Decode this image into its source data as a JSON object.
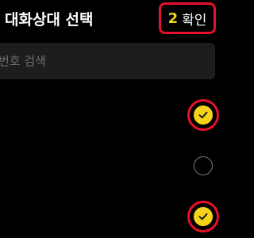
{
  "header": {
    "title": "대화상대 선택",
    "selected_count": "2",
    "confirm_label": "확인"
  },
  "search": {
    "placeholder": "번호 검색",
    "value": ""
  },
  "list": {
    "rows": [
      {
        "checked": true
      },
      {
        "checked": false
      },
      {
        "checked": true
      }
    ]
  },
  "colors": {
    "background": "#000000",
    "accent_yellow": "#f5d31b",
    "highlight_red": "#e8102a",
    "search_bg": "#1d1d1f"
  }
}
